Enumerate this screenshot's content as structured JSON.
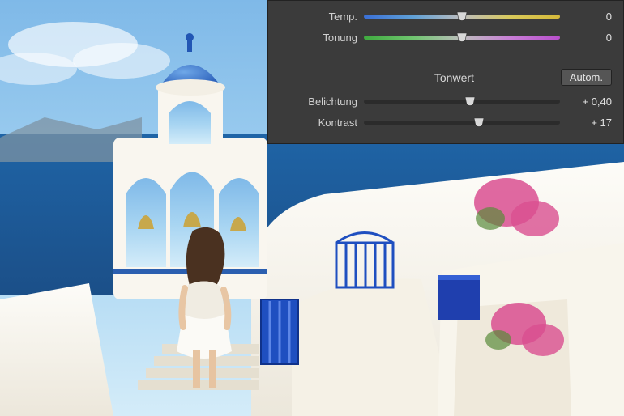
{
  "panel": {
    "wb": {
      "temp": {
        "label": "Temp.",
        "value": 0,
        "display": "0",
        "pos": 50,
        "track": "temp"
      },
      "tint": {
        "label": "Tonung",
        "value": 0,
        "display": "0",
        "pos": 50,
        "track": "tint"
      }
    },
    "tone": {
      "section_label": "Tonwert",
      "auto_label": "Autom.",
      "exposure": {
        "label": "Belichtung",
        "value": 0.4,
        "display": "+ 0,40",
        "pos": 54,
        "track": "gray"
      },
      "contrast": {
        "label": "Kontrast",
        "value": 17,
        "display": "+ 17",
        "pos": 58.5,
        "track": "gray"
      }
    }
  }
}
